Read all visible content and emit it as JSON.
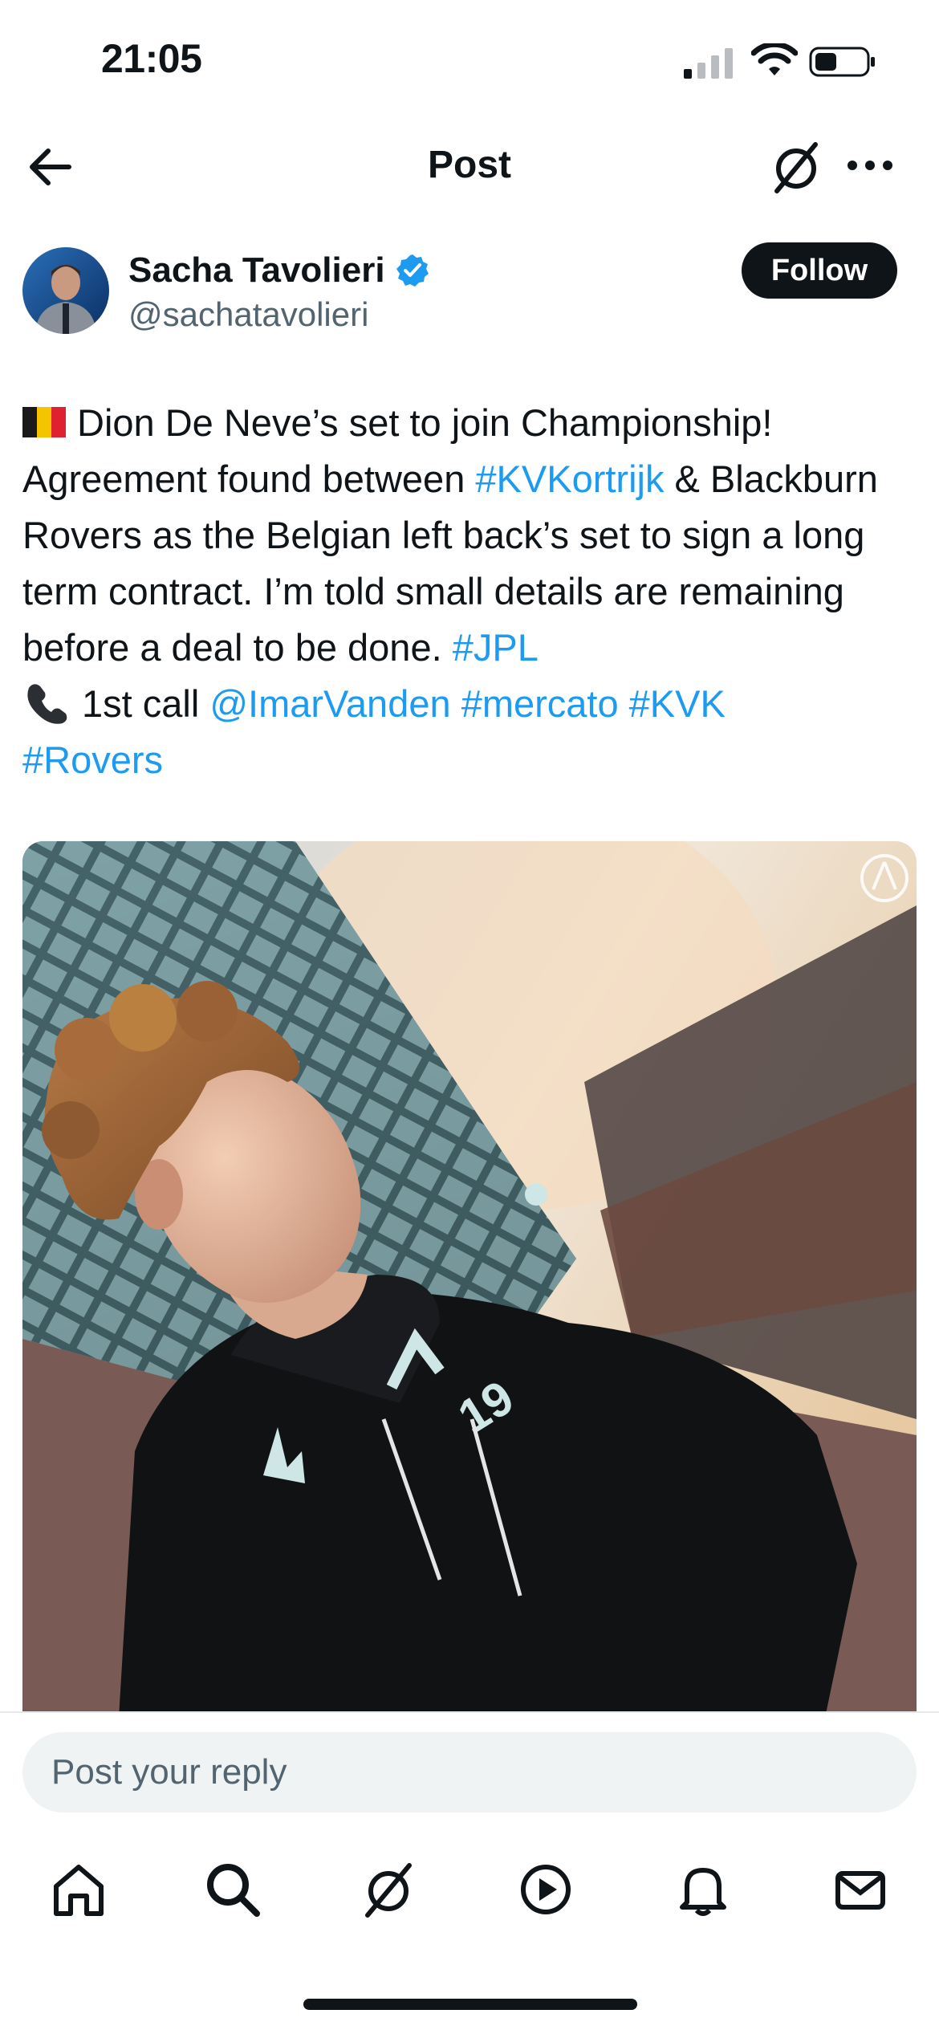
{
  "status_bar": {
    "time": "21:05",
    "icons": [
      "cellular-signal-icon",
      "wifi-icon",
      "battery-icon"
    ]
  },
  "header": {
    "title": "Post",
    "icons": [
      "back-arrow-icon",
      "grok-icon",
      "more-icon"
    ]
  },
  "author": {
    "name": "Sacha Tavolieri",
    "handle": "@sachatavolieri",
    "verified": true,
    "follow_label": "Follow"
  },
  "post": {
    "segments": [
      {
        "type": "emoji",
        "icon": "belgium-flag-icon"
      },
      {
        "type": "text",
        "text": "Dion De Neve’s set to join Championship! Agreement found between "
      },
      {
        "type": "link",
        "text": "#KVKortrijk"
      },
      {
        "type": "text",
        "text": " & Blackburn Rovers as the Belgian left back’s set to sign a long term contract. I’m told small details are remaining before a deal to be done. "
      },
      {
        "type": "link",
        "text": "#JPL"
      },
      {
        "type": "break"
      },
      {
        "type": "emoji",
        "icon": "telephone-icon"
      },
      {
        "type": "text",
        "text": "1st call "
      },
      {
        "type": "link",
        "text": "@ImarVanden"
      },
      {
        "type": "text",
        "text": " "
      },
      {
        "type": "link",
        "text": "#mercato"
      },
      {
        "type": "text",
        "text": " "
      },
      {
        "type": "link",
        "text": "#KVK"
      },
      {
        "type": "break"
      },
      {
        "type": "link",
        "text": "#Rovers"
      }
    ],
    "media_hoodie_number": "19"
  },
  "reply": {
    "placeholder": "Post your reply"
  },
  "tab_bar": {
    "items": [
      "home-icon",
      "search-icon",
      "grok-icon",
      "video-icon",
      "notifications-icon",
      "messages-icon"
    ]
  },
  "colors": {
    "link": "#1d9bf0",
    "text": "#0f1419",
    "secondary": "#536471",
    "follow_bg": "#0f1419"
  }
}
